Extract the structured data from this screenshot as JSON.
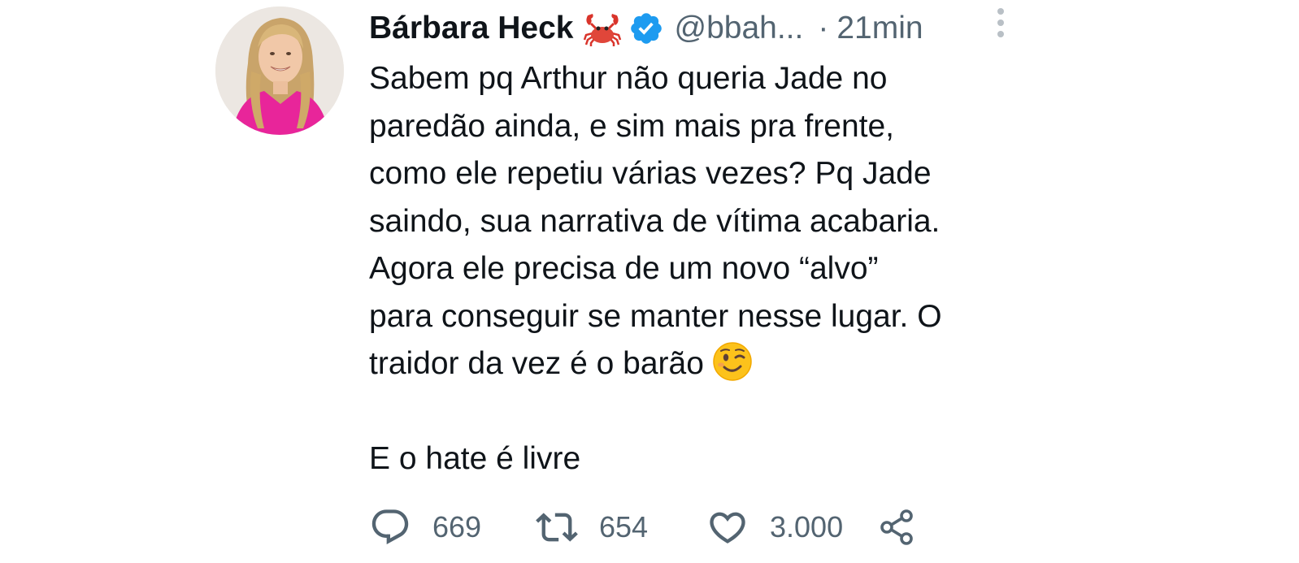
{
  "tweet": {
    "display_name": "Bárbara Heck",
    "name_emoji": "crab-icon",
    "verified_icon": "verified-badge-icon",
    "handle": "@bbah...",
    "separator": "·",
    "time": "21min",
    "text_main": "Sabem pq Arthur não queria Jade no\nparedão ainda, e sim mais pra frente,\ncomo ele repetiu várias vezes? Pq Jade\nsaindo, sua narrativa de vítima acabaria.\nAgora ele precisa de um novo “alvo”\npara conseguir se manter nesse lugar. O\ntraidor da vez é o barão",
    "text_emoji": "winking-face-icon",
    "text_second": "E o hate é livre"
  },
  "actions": {
    "reply_count": "669",
    "retweet_count": "654",
    "like_count": "3.000"
  },
  "colors": {
    "text": "#0f1419",
    "secondary": "#536471",
    "verified_blue": "#1d9bf0"
  }
}
